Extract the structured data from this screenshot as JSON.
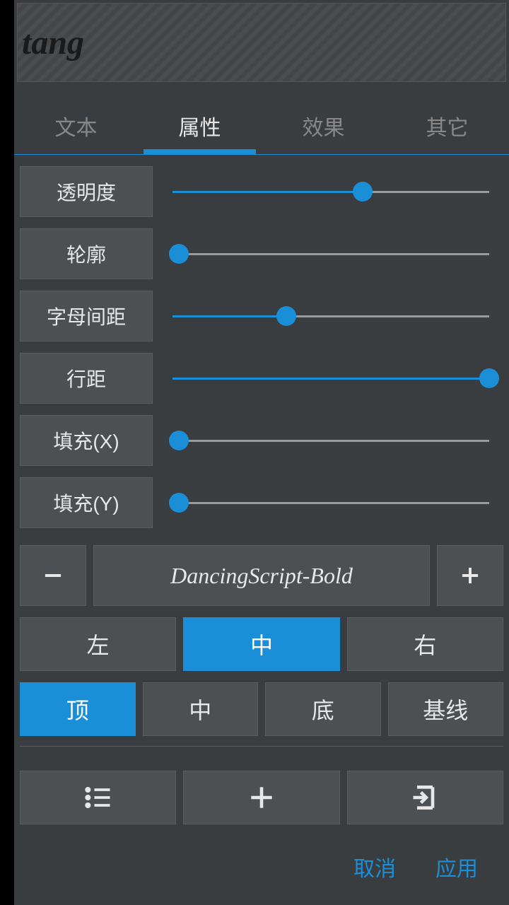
{
  "preview": {
    "text": "tang"
  },
  "tabs": {
    "items": [
      "文本",
      "属性",
      "效果",
      "其它"
    ],
    "activeIndex": 1
  },
  "sliders": [
    {
      "label": "透明度",
      "value": 60
    },
    {
      "label": "轮廓",
      "value": 2
    },
    {
      "label": "字母间距",
      "value": 36
    },
    {
      "label": "行距",
      "value": 100
    },
    {
      "label": "填充(X)",
      "value": 2
    },
    {
      "label": "填充(Y)",
      "value": 2
    }
  ],
  "font": {
    "name": "DancingScript-Bold"
  },
  "hAlign": {
    "options": [
      "左",
      "中",
      "右"
    ],
    "activeIndex": 1
  },
  "vAlign": {
    "options": [
      "顶",
      "中",
      "底",
      "基线"
    ],
    "activeIndex": 0
  },
  "actions": {
    "cancel": "取消",
    "apply": "应用"
  }
}
